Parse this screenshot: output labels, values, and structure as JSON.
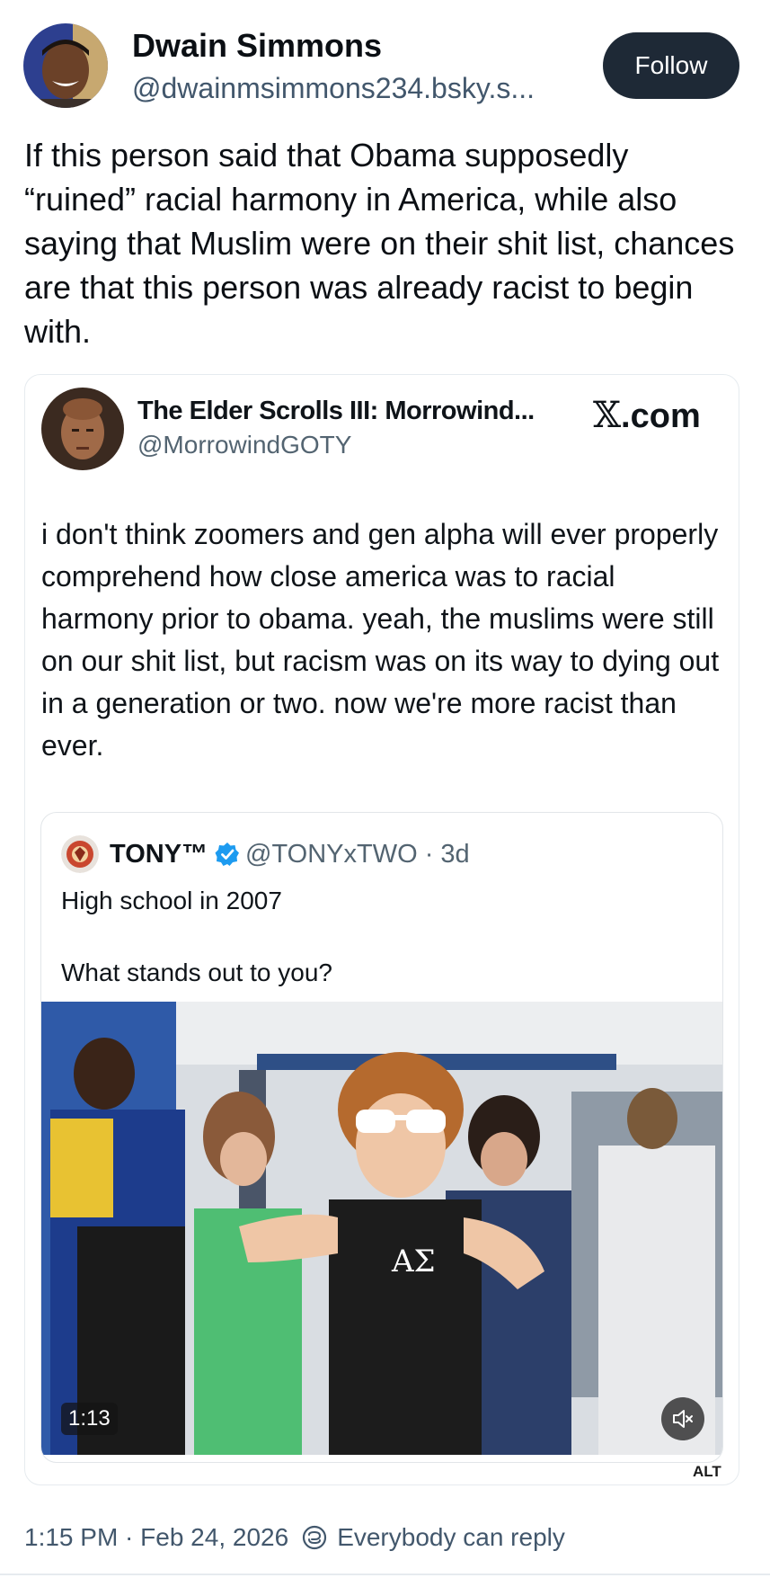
{
  "post": {
    "author_name": "Dwain Simmons",
    "author_handle": "@dwainmsimmons234.bsky.s...",
    "follow_label": "Follow",
    "text": "If this person said that Obama supposedly “ruined” racial harmony in America, while also saying that Muslim were on their shit list, chances are that this person was already racist to begin with.",
    "timestamp": "1:15 PM · Feb 24, 2026",
    "reply_setting": "Everybody can reply"
  },
  "embed": {
    "author_name": "The Elder Scrolls III: Morrowind...",
    "author_handle": "@MorrowindGOTY",
    "source_label": ".com",
    "source_icon": "x-logo",
    "text": "i don't think zoomers and gen alpha will ever properly comprehend how close america was to racial harmony prior to obama. yeah, the muslims were still on our shit list, but racism was on its way to dying out in a generation or two. now we're more racist than ever.",
    "quote": {
      "author_name": "TONY™",
      "author_handle": "@TONYxTWO · 3d",
      "line1": "High school in 2007",
      "line2": "What stands out to you?",
      "video_duration": "1:13",
      "alt_label": "ALT"
    }
  },
  "colors": {
    "follow_bg": "#1e2936",
    "secondary_text": "#42576c",
    "verified_blue": "#1d9bf0"
  }
}
